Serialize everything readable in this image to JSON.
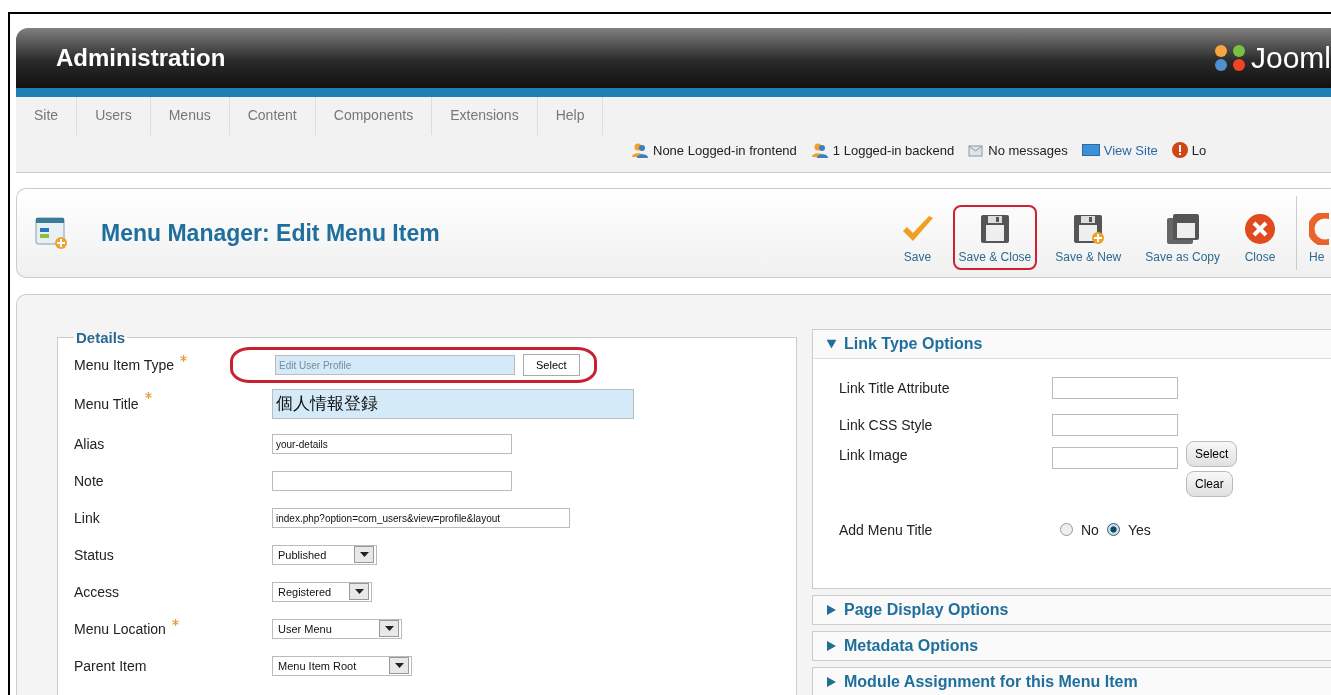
{
  "header": {
    "title": "Administration",
    "logo_text": "Jooml"
  },
  "menu": [
    {
      "label": "Site"
    },
    {
      "label": "Users"
    },
    {
      "label": "Menus"
    },
    {
      "label": "Content"
    },
    {
      "label": "Components"
    },
    {
      "label": "Extensions"
    },
    {
      "label": "Help"
    }
  ],
  "status": [
    {
      "kind": "users",
      "text": "None Logged-in frontend"
    },
    {
      "kind": "users",
      "text": "1 Logged-in backend"
    },
    {
      "kind": "messages",
      "text": "No messages"
    },
    {
      "kind": "view",
      "text": "View Site"
    },
    {
      "kind": "logout",
      "text": "Lo"
    }
  ],
  "toolbar": {
    "title": "Menu Manager: Edit Menu Item",
    "buttons": [
      {
        "kind": "save",
        "label": "Save",
        "highlighted": false
      },
      {
        "kind": "save-close",
        "label": "Save & Close",
        "highlighted": true
      },
      {
        "kind": "save-new",
        "label": "Save & New",
        "highlighted": false
      },
      {
        "kind": "save-copy",
        "label": "Save as Copy",
        "highlighted": false
      },
      {
        "kind": "close",
        "label": "Close",
        "highlighted": false
      },
      {
        "kind": "help",
        "label": "He",
        "highlighted": false
      }
    ]
  },
  "details": {
    "legend": "Details",
    "fields": [
      {
        "kind": "type",
        "label": "Menu Item Type",
        "required": true,
        "value": "Edit User Profile",
        "button": "Select",
        "highlighted": true
      },
      {
        "kind": "title",
        "label": "Menu Title",
        "required": true,
        "value": "個人情報登録"
      },
      {
        "kind": "text",
        "label": "Alias",
        "required": false,
        "value": "your-details"
      },
      {
        "kind": "text",
        "label": "Note",
        "required": false
      },
      {
        "kind": "link",
        "label": "Link",
        "required": false,
        "value": "index.php?option=com_users&view=profile&layout"
      },
      {
        "kind": "select",
        "label": "Status",
        "required": false,
        "value": "Published"
      },
      {
        "kind": "select",
        "label": "Access",
        "required": false,
        "value": "Registered"
      },
      {
        "kind": "select",
        "label": "Menu Location",
        "required": true,
        "value": "User Menu"
      },
      {
        "kind": "select",
        "label": "Parent Item",
        "required": false,
        "value": "Menu Item Root"
      }
    ]
  },
  "options": {
    "panels": [
      {
        "title": "Link Type Options",
        "expanded": true,
        "fields": [
          {
            "kind": "text",
            "label": "Link Title Attribute"
          },
          {
            "kind": "text",
            "label": "Link CSS Style"
          },
          {
            "kind": "image",
            "label": "Link Image",
            "buttons": [
              "Select",
              "Clear"
            ]
          },
          {
            "kind": "radio",
            "label": "Add Menu Title",
            "options": [
              {
                "label": "No",
                "selected": false
              },
              {
                "label": "Yes",
                "selected": true
              }
            ]
          }
        ]
      },
      {
        "title": "Page Display Options",
        "expanded": false
      },
      {
        "title": "Metadata Options",
        "expanded": false
      },
      {
        "title": "Module Assignment for this Menu Item",
        "expanded": false
      }
    ]
  }
}
